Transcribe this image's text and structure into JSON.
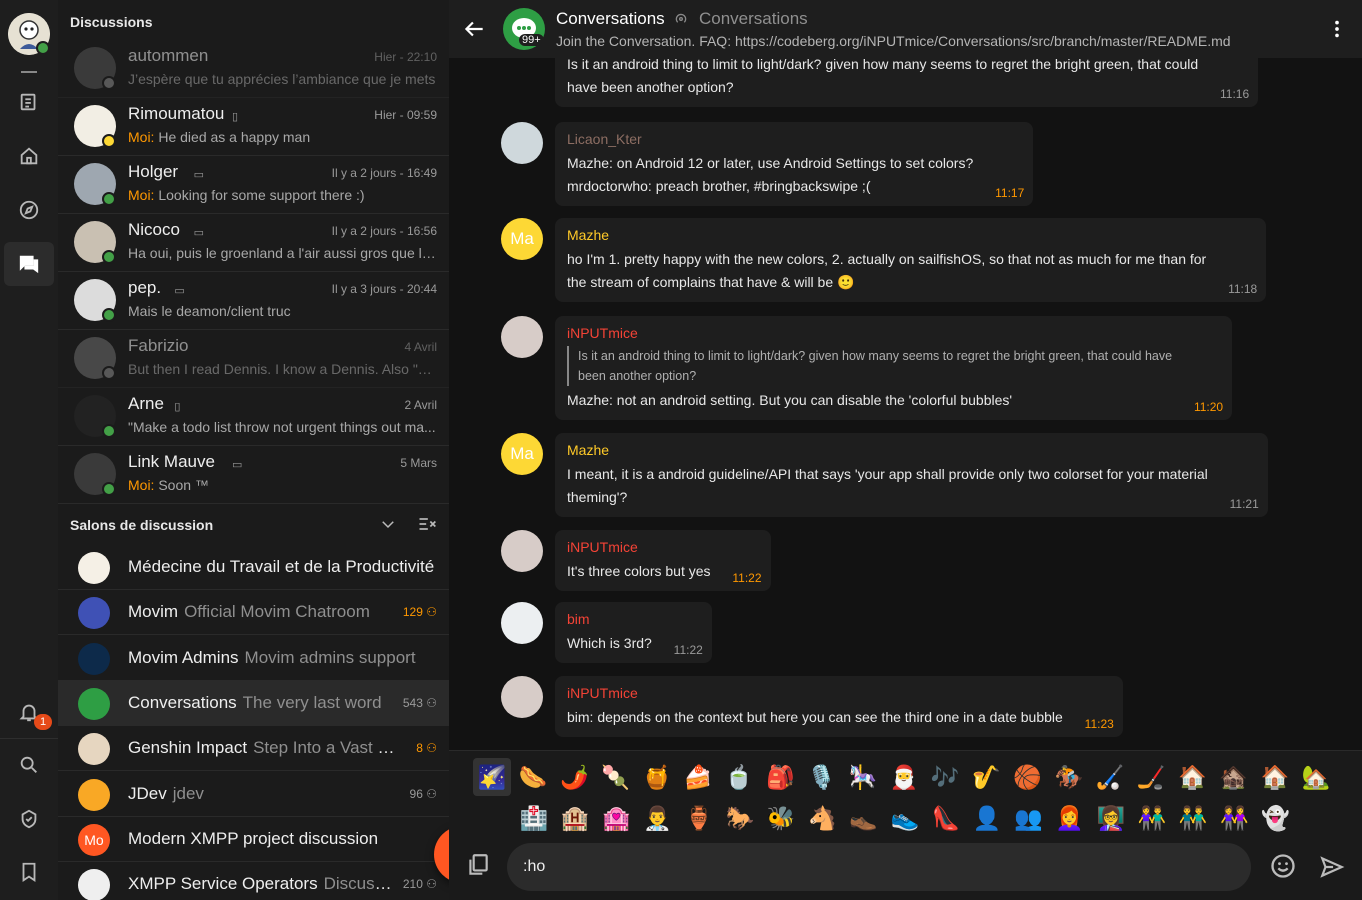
{
  "sidebar": {
    "discussions_title": "Discussions",
    "rooms_title": "Salons de discussion",
    "notif_count": "1"
  },
  "contacts": [
    {
      "name": "autommen",
      "device": "",
      "time": "Hier - 22:10",
      "preview": "J’espère que tu apprécies l’ambiance que je mets",
      "moi": "",
      "presence": "#8a8a8a",
      "dim": true
    },
    {
      "name": "Rimoumatou",
      "device": "phone",
      "time": "Hier - 09:59",
      "preview": "He died as a happy man",
      "moi": "Moi:",
      "presence": "#fdd835"
    },
    {
      "name": "Holger",
      "device": "laptop",
      "time": "Il y a 2 jours - 16:49",
      "preview": "Looking for some support there :)",
      "moi": "Moi:",
      "presence": "#43a047"
    },
    {
      "name": "Nicoco",
      "device": "desktop",
      "time": "Il y a 2 jours - 16:56",
      "preview": "Ha oui, puis le groenland a l'air aussi gros que l'a...",
      "moi": "",
      "presence": "#43a047"
    },
    {
      "name": "pep.",
      "device": "laptop",
      "time": "Il y a 3 jours - 20:44",
      "preview": "Mais le deamon/client truc",
      "moi": "",
      "presence": "#43a047"
    },
    {
      "name": "Fabrizio",
      "device": "",
      "time": "4 Avril",
      "preview": "But then I read Dennis. I know a Dennis. Also \"ou...",
      "moi": "",
      "presence": "#8a8a8a",
      "dim": true
    },
    {
      "name": "Arne",
      "device": "phone",
      "time": "2 Avril",
      "preview": "\"Make a todo list throw not urgent things out ma...",
      "moi": "",
      "presence": "#43a047"
    },
    {
      "name": "Link Mauve",
      "device": "laptop",
      "time": "5 Mars",
      "preview": "Soon ™",
      "moi": "Moi:",
      "presence": "#43a047"
    }
  ],
  "rooms": [
    {
      "name": "Médecine du Travail et de la Productivité",
      "desc": "",
      "count": ""
    },
    {
      "name": "Movim",
      "desc": "Official Movim Chatroom",
      "count": "129",
      "hot": true
    },
    {
      "name": "Movim Admins",
      "desc": "Movim admins support",
      "count": ""
    },
    {
      "name": "Conversations",
      "desc": "The very last word",
      "count": "543"
    },
    {
      "name": "Genshin Impact",
      "desc": "Step Into a Vast Magical World",
      "count": "8",
      "hot": true
    },
    {
      "name": "JDev",
      "desc": "jdev",
      "count": "96"
    },
    {
      "name": "Modern XMPP project discussion",
      "desc": "",
      "count": ""
    },
    {
      "name": "XMPP Service Operators",
      "desc": "Discussion",
      "count": "210"
    }
  ],
  "header": {
    "title": "Conversations",
    "subtitle": "Conversations",
    "topic": "Join the Conversation. FAQ: https://codeberg.org/iNPUTmice/Conversations/src/branch/master/README.md",
    "badge": "99+"
  },
  "messages": [
    {
      "author": "",
      "color": "",
      "lines": [
        "Is it an android thing to limit to light/dark? given how many seems to regret the bright green, that could",
        "have been another option?"
      ],
      "time": "11:16",
      "own": false
    },
    {
      "author": "Licaon_Kter",
      "color": "#8d6e63",
      "lines": [
        "Mazhe: on Android 12 or later, use Android Settings to set colors?",
        "mrdoctorwho: preach brother, #bringbackswipe ;("
      ],
      "time": "11:17",
      "own": true
    },
    {
      "author": "Mazhe",
      "color": "#ffca28",
      "initials": "Ma",
      "lines": [
        "ho I'm 1. pretty happy with the new colors, 2. actually on sailfishOS, so that not as much for me than for",
        "the stream of complains that have & will be 🙂"
      ],
      "time": "11:18",
      "own": false
    },
    {
      "author": "iNPUTmice",
      "color": "#f44336",
      "quote": [
        "Is it an android thing to limit to light/dark? given how many seems to regret the bright green, that could have",
        "been another option?"
      ],
      "lines": [
        "Mazhe: not an android setting. But you can disable the 'colorful bubbles'"
      ],
      "time": "11:20",
      "own": true
    },
    {
      "author": "Mazhe",
      "color": "#ffca28",
      "initials": "Ma",
      "lines": [
        "I meant, it is a android guideline/API that says 'your app shall provide only two colorset for your material",
        "theming'?"
      ],
      "time": "11:21",
      "own": false
    },
    {
      "author": "iNPUTmice",
      "color": "#f44336",
      "lines": [
        "It's three colors but yes"
      ],
      "time": "11:22",
      "own": true
    },
    {
      "author": "bim",
      "color": "#f44336",
      "lines": [
        "Which is 3rd?"
      ],
      "time": "11:22",
      "own": false
    },
    {
      "author": "iNPUTmice",
      "color": "#f44336",
      "lines": [
        "bim: depends on the context but here you can see the third one in a date bubble"
      ],
      "time": "11:23",
      "own": true
    }
  ],
  "emojis": {
    "row1": [
      "🌠",
      "🌭",
      "🌶️",
      "🍡",
      "🍯",
      "🍰",
      "🍵",
      "🎒",
      "🎙️",
      "🎠",
      "🎅",
      "🎶",
      "🎷",
      "🏀",
      "🏇",
      "🏑",
      "🏒",
      "🏠",
      "🏚️",
      "🏠",
      "🏡"
    ],
    "row2": [
      "🏥",
      "🏨",
      "🏩",
      "👨‍⚕️",
      "🏺",
      "🐎",
      "🐝",
      "🐴",
      "👞",
      "👟",
      "👠",
      "👤",
      "👥",
      "👩‍🦰",
      "👩‍🏫",
      "👫",
      "👬",
      "👭",
      "👻"
    ]
  },
  "composer": {
    "value": ":ho"
  },
  "colors": {
    "accent": "#ff5722",
    "own_time": "#ff9800",
    "moi": "#ff9800"
  }
}
